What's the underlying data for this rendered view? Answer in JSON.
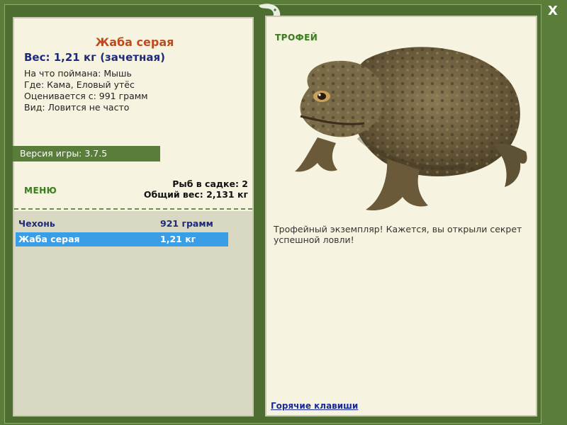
{
  "window": {
    "close_label": "X"
  },
  "catch": {
    "fish_name": "Жаба серая",
    "weight_line": "Вес: 1,21 кг (зачетная)",
    "bait": "На что поймана: Мышь",
    "location": "Где: Кама, Еловый утёс",
    "threshold": "Оценивается с: 991 грамм",
    "rarity": "Вид: Ловится не часто"
  },
  "version": "Версия игры: 3.7.5",
  "menu_label": "МЕНЮ",
  "stats": {
    "count": "Рыб в садке: 2",
    "total": "Общий вес: 2,131 кг"
  },
  "keepnet": [
    {
      "name": "Чехонь",
      "weight": "921 грамм",
      "selected": false
    },
    {
      "name": "Жаба серая",
      "weight": "1,21 кг",
      "selected": true
    }
  ],
  "trophy": {
    "label": "ТРОФЕЙ",
    "text": "Трофейный экземпляр! Кажется, вы открыли секрет успешной ловли!"
  },
  "hotkeys_label": "Горячие клавиши",
  "colors": {
    "frame": "#5a7d3a",
    "panel": "#f6f4e0",
    "title": "#c04a1e",
    "accent_text": "#1f2a7a",
    "selection": "#3a9ee6"
  },
  "icons": {
    "logo": "lizard-logo-icon",
    "close": "close-icon",
    "image": "toad-image"
  }
}
